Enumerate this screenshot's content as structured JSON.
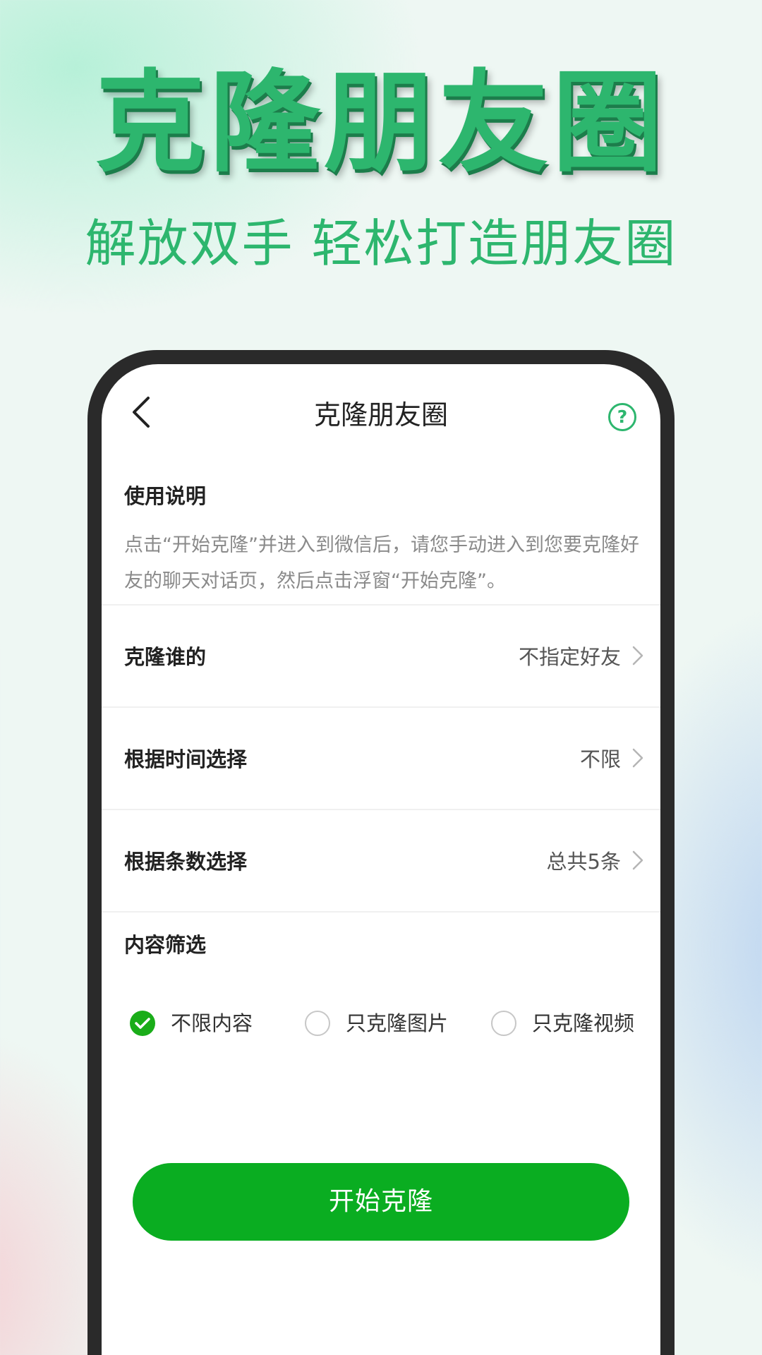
{
  "banner": {
    "headline": "克隆朋友圈",
    "subline": "解放双手 轻松打造朋友圈"
  },
  "nav": {
    "title": "克隆朋友圈",
    "back_icon": "chevron-left-icon",
    "help_icon": "question-circle-icon",
    "help_glyph": "?"
  },
  "instructions": {
    "title": "使用说明",
    "body": "点击“开始克隆”并进入到微信后，请您手动进入到您要克隆好友的聊天对话页，然后点击浮窗“开始克隆”。"
  },
  "settings": [
    {
      "label": "克隆谁的",
      "value": "不指定好友"
    },
    {
      "label": "根据时间选择",
      "value": "不限"
    },
    {
      "label": "根据条数选择",
      "value": "总共5条"
    }
  ],
  "content_filter": {
    "title": "内容筛选",
    "options": [
      {
        "label": "不限内容",
        "selected": true
      },
      {
        "label": "只克隆图片",
        "selected": false
      },
      {
        "label": "只克隆视频",
        "selected": false
      }
    ]
  },
  "start_button": {
    "label": "开始克隆"
  },
  "colors": {
    "brand_green": "#2db66e",
    "button_green": "#0aad21",
    "check_green": "#1aad19"
  }
}
